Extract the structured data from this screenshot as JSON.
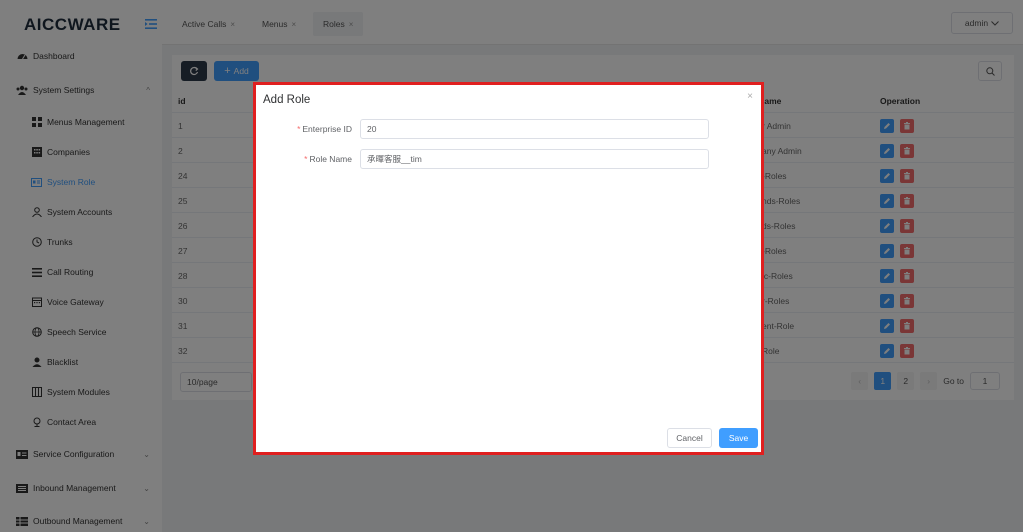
{
  "app": {
    "logo_part1": "AICC",
    "logo_part2": "WARE"
  },
  "colors": {
    "primary": "#409eff",
    "danger": "#f56c6c",
    "dark": "#2d3a4b",
    "highlight_border": "#e01f1f"
  },
  "sidebar": {
    "dashboard": "Dashboard",
    "system_settings": "System Settings",
    "sub_items": [
      {
        "label": "Menus Management",
        "icon": "grid-icon"
      },
      {
        "label": "Companies",
        "icon": "building-icon"
      },
      {
        "label": "System Role",
        "icon": "role-card-icon"
      },
      {
        "label": "System Accounts",
        "icon": "user-icon"
      },
      {
        "label": "Trunks",
        "icon": "clock-icon"
      },
      {
        "label": "Call Routing",
        "icon": "list-icon"
      },
      {
        "label": "Voice Gateway",
        "icon": "calendar-icon"
      },
      {
        "label": "Speech Service",
        "icon": "globe-icon"
      },
      {
        "label": "Blacklist",
        "icon": "person-icon"
      },
      {
        "label": "System Modules",
        "icon": "module-icon"
      },
      {
        "label": "Contact Area",
        "icon": "pin-icon"
      }
    ],
    "service_configuration": "Service Configuration",
    "inbound_management": "Inbound Management",
    "outbound_management": "Outbound Management"
  },
  "tabs": [
    {
      "label": "Active Calls"
    },
    {
      "label": "Menus"
    },
    {
      "label": "Roles"
    }
  ],
  "user": {
    "name": "admin"
  },
  "toolbar": {
    "add_label": "Add"
  },
  "table": {
    "headers": {
      "id": "id",
      "name": "lame",
      "operation": "Operation"
    },
    "rows": [
      {
        "id": "1",
        "name": "r Admin"
      },
      {
        "id": "2",
        "name": "any Admin"
      },
      {
        "id": "24",
        "name": "-Roles"
      },
      {
        "id": "25",
        "name": "nds-Roles"
      },
      {
        "id": "26",
        "name": "ds-Roles"
      },
      {
        "id": "27",
        "name": "-Roles"
      },
      {
        "id": "28",
        "name": "ic-Roles"
      },
      {
        "id": "30",
        "name": "r-Roles"
      },
      {
        "id": "31",
        "name": "ent-Role"
      },
      {
        "id": "32",
        "name": "Role"
      }
    ]
  },
  "pagination": {
    "page_size": "10/page",
    "pages": [
      "1",
      "2"
    ],
    "current": "1",
    "goto_label": "Go to",
    "goto_value": "1"
  },
  "modal": {
    "title": "Add Role",
    "fields": [
      {
        "label": "Enterprise ID",
        "value": "20",
        "required": true
      },
      {
        "label": "Role Name",
        "value": "承暉客服__tim",
        "required": true
      }
    ],
    "cancel_label": "Cancel",
    "save_label": "Save"
  }
}
